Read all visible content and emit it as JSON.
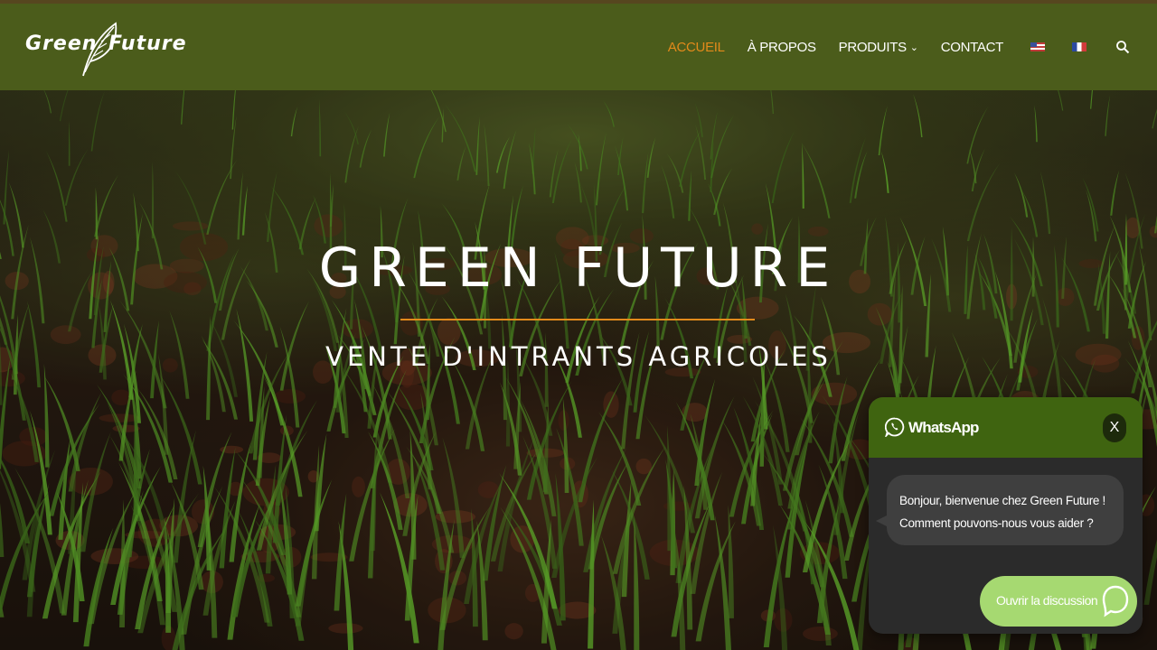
{
  "brand": {
    "logo_left": "Green",
    "logo_right": "Future"
  },
  "nav": {
    "items": [
      {
        "label": "ACCUEIL",
        "active": true
      },
      {
        "label": "À PROPOS",
        "active": false
      },
      {
        "label": "PRODUITS",
        "active": false,
        "has_dropdown": true
      },
      {
        "label": "CONTACT",
        "active": false
      }
    ],
    "languages": [
      {
        "icon": "us-flag-icon"
      },
      {
        "icon": "fr-flag-icon"
      }
    ],
    "search_icon": "search-icon"
  },
  "hero": {
    "title": "GREEN FUTURE",
    "subtitle": "VENTE D'INTRANTS AGRICOLES"
  },
  "whatsapp": {
    "brand": "WhatsApp",
    "close_label": "X",
    "message_line1": "Bonjour, bienvenue chez Green Future !",
    "message_line2": "Comment pouvons-nous vous aider ?",
    "open_button_label": "Ouvrir la discussion"
  },
  "colors": {
    "header_bg": "#4b5c1b",
    "accent": "#e28a1b",
    "whatsapp_header": "#3f6410",
    "whatsapp_button": "#a6d971"
  }
}
